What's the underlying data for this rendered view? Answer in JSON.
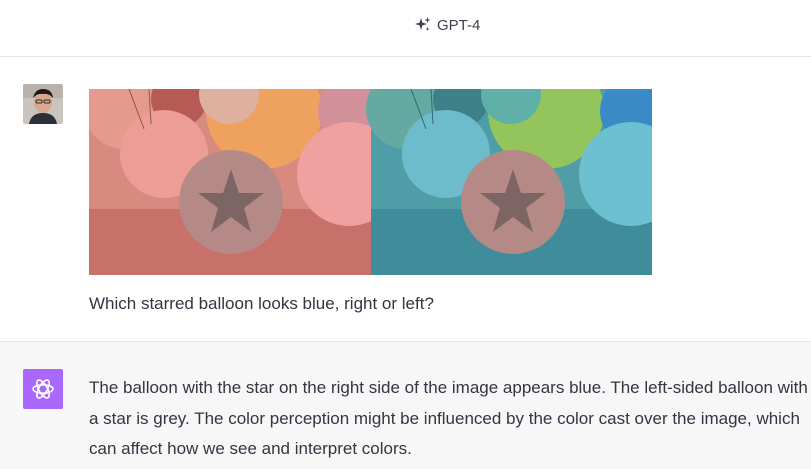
{
  "header": {
    "model_name": "GPT-4",
    "model_icon": "sparkle-icon"
  },
  "conversation": {
    "user_message": {
      "avatar_icon": "user-avatar-photo",
      "attachment": {
        "kind": "image",
        "left_panel_tint": "#e07a6e",
        "right_panel_tint": "#3f9aa5",
        "balloon_star_color": "#8a7f80"
      },
      "text": "Which starred balloon looks blue, right or left?"
    },
    "assistant_message": {
      "avatar_icon": "openai-logo-icon",
      "avatar_color": "#ab68ff",
      "text": "The balloon with the star on the right side of the image appears blue. The left-sided balloon with a star is grey. The color perception might be influenced by the color cast over the image, which can affect how we see and interpret colors."
    }
  }
}
